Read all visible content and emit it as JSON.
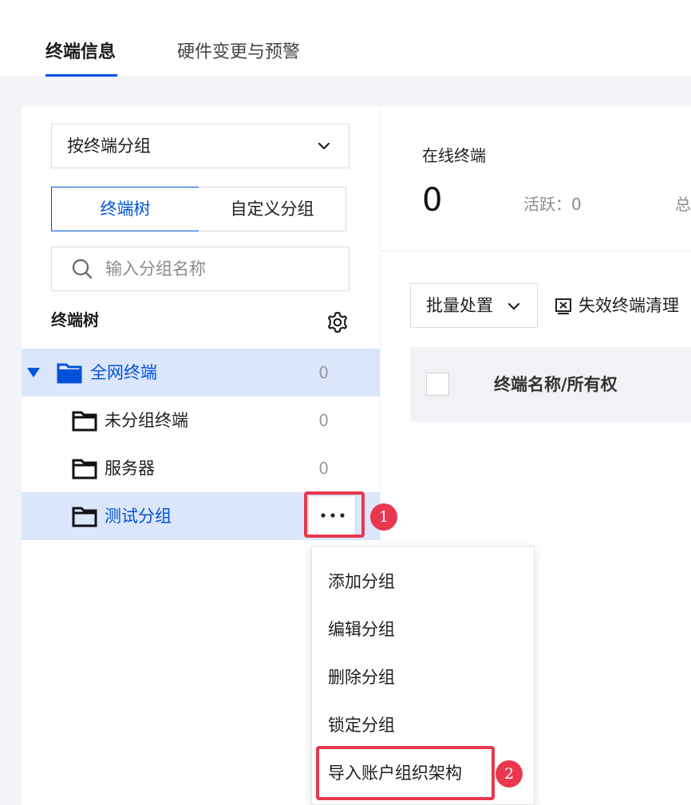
{
  "tabs": [
    {
      "label": "终端信息",
      "active": true
    },
    {
      "label": "硬件变更与预警",
      "active": false
    }
  ],
  "group_select": {
    "value": "按终端分组"
  },
  "segment": {
    "tree": "终端树",
    "custom": "自定义分组",
    "selected": "终端树"
  },
  "search": {
    "placeholder": "输入分组名称"
  },
  "tree": {
    "heading": "终端树",
    "nodes": [
      {
        "label": "全网终端",
        "count": "0"
      },
      {
        "label": "未分组终端",
        "count": "0"
      },
      {
        "label": "服务器",
        "count": "0"
      },
      {
        "label": "测试分组"
      }
    ]
  },
  "context_menu": {
    "items": [
      "添加分组",
      "编辑分组",
      "删除分组",
      "锁定分组",
      "导入账户组织架构"
    ]
  },
  "annotations": {
    "step1": "1",
    "step2": "2"
  },
  "stats": {
    "online_label": "在线终端",
    "online_value": "0",
    "active_text": "活跃：0",
    "total_text_partial": "总"
  },
  "toolbar": {
    "bulk": "批量处置",
    "cleanup": "失效终端清理"
  },
  "table": {
    "columns": [
      "终端名称/所有权"
    ]
  },
  "colors": {
    "accent": "#0052d9",
    "selected_bg": "#dbe6fb",
    "annotation": "#e8384f"
  }
}
